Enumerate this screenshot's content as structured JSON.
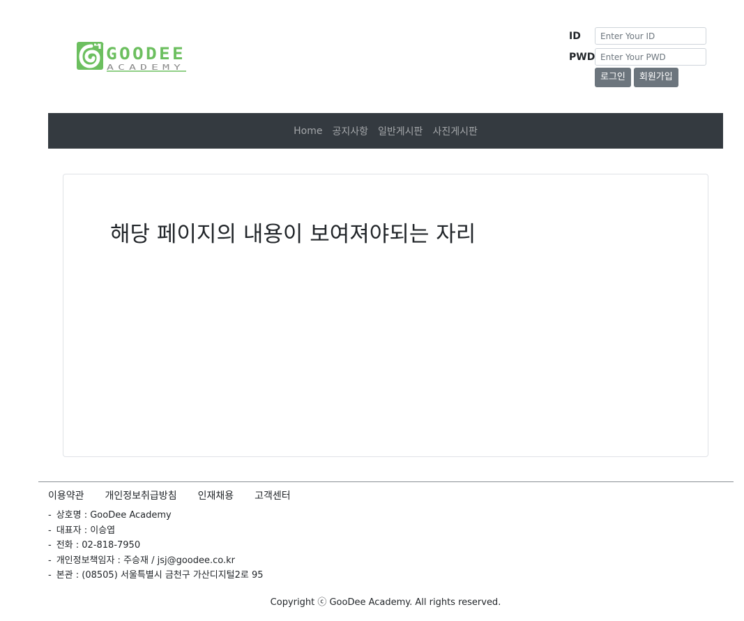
{
  "brand": {
    "logo_text": "GOODEE",
    "logo_subtext": "ACADEMY",
    "colors": {
      "green": "#6cbf5f",
      "gray": "#7c7c7c"
    }
  },
  "login": {
    "id_label": "ID",
    "id_placeholder": "Enter Your ID",
    "pwd_label": "PWD",
    "pwd_placeholder": "Enter Your PWD",
    "login_button": "로그인",
    "signup_button": "회원가입"
  },
  "nav": {
    "items": [
      {
        "label": "Home"
      },
      {
        "label": "공지사항"
      },
      {
        "label": "일반게시판"
      },
      {
        "label": "사진게시판"
      }
    ]
  },
  "main": {
    "content_text": "해당 페이지의 내용이 보여져야되는 자리"
  },
  "footer": {
    "links": [
      {
        "label": "이용약관"
      },
      {
        "label": "개인정보취급방침"
      },
      {
        "label": "인재채용"
      },
      {
        "label": "고객센터"
      }
    ],
    "info": [
      "상호명 : GooDee Academy",
      "대표자 : 이승엽",
      "전화 : 02-818-7950",
      "개인정보책임자 : 주승재 / jsj@goodee.co.kr",
      "본관 : (08505) 서울특별시 금천구 가산디지털2로 95"
    ],
    "copyright": "Copyright ⓒ GooDee Academy. All rights reserved."
  },
  "theme": {
    "navbar_bg": "#343a40",
    "button_bg": "#6c757d"
  }
}
